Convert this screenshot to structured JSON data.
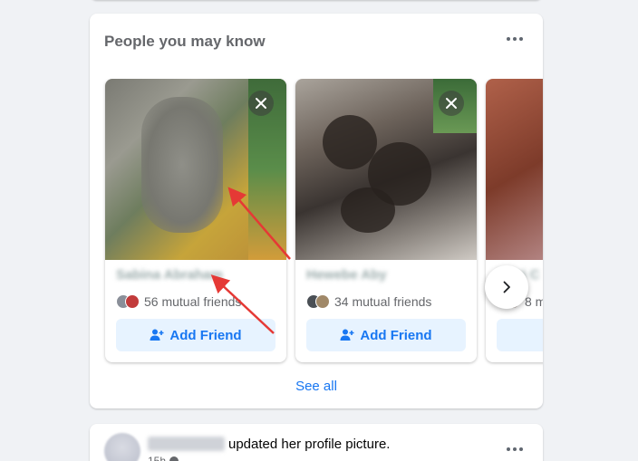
{
  "section": {
    "title": "People you may know",
    "see_all": "See all"
  },
  "suggestions": [
    {
      "name": "Sabina Abraham",
      "mutual": "56 mutual friends",
      "add_label": "Add Friend",
      "avatar_colors": [
        "#8a8f99",
        "#c23b3b"
      ]
    },
    {
      "name": "Hewebe Aby",
      "mutual": "34 mutual friends",
      "add_label": "Add Friend",
      "avatar_colors": [
        "#4a4f55",
        "#a08868"
      ]
    },
    {
      "name": "Rani C",
      "mutual": "8 m",
      "add_label": "",
      "avatar_colors": [
        "#8bbf5a",
        "#a89d98"
      ]
    }
  ],
  "post": {
    "author": "",
    "action": "updated her profile picture.",
    "time": "15h"
  },
  "icons": {
    "more": "more-horizontal-icon",
    "close": "close-icon",
    "add_friend": "add-friend-icon",
    "next": "chevron-right-icon"
  },
  "colors": {
    "accent": "#1877f2",
    "button_bg": "#e7f3ff",
    "page_bg": "#f0f2f5",
    "annotation_arrow": "#e53935"
  }
}
